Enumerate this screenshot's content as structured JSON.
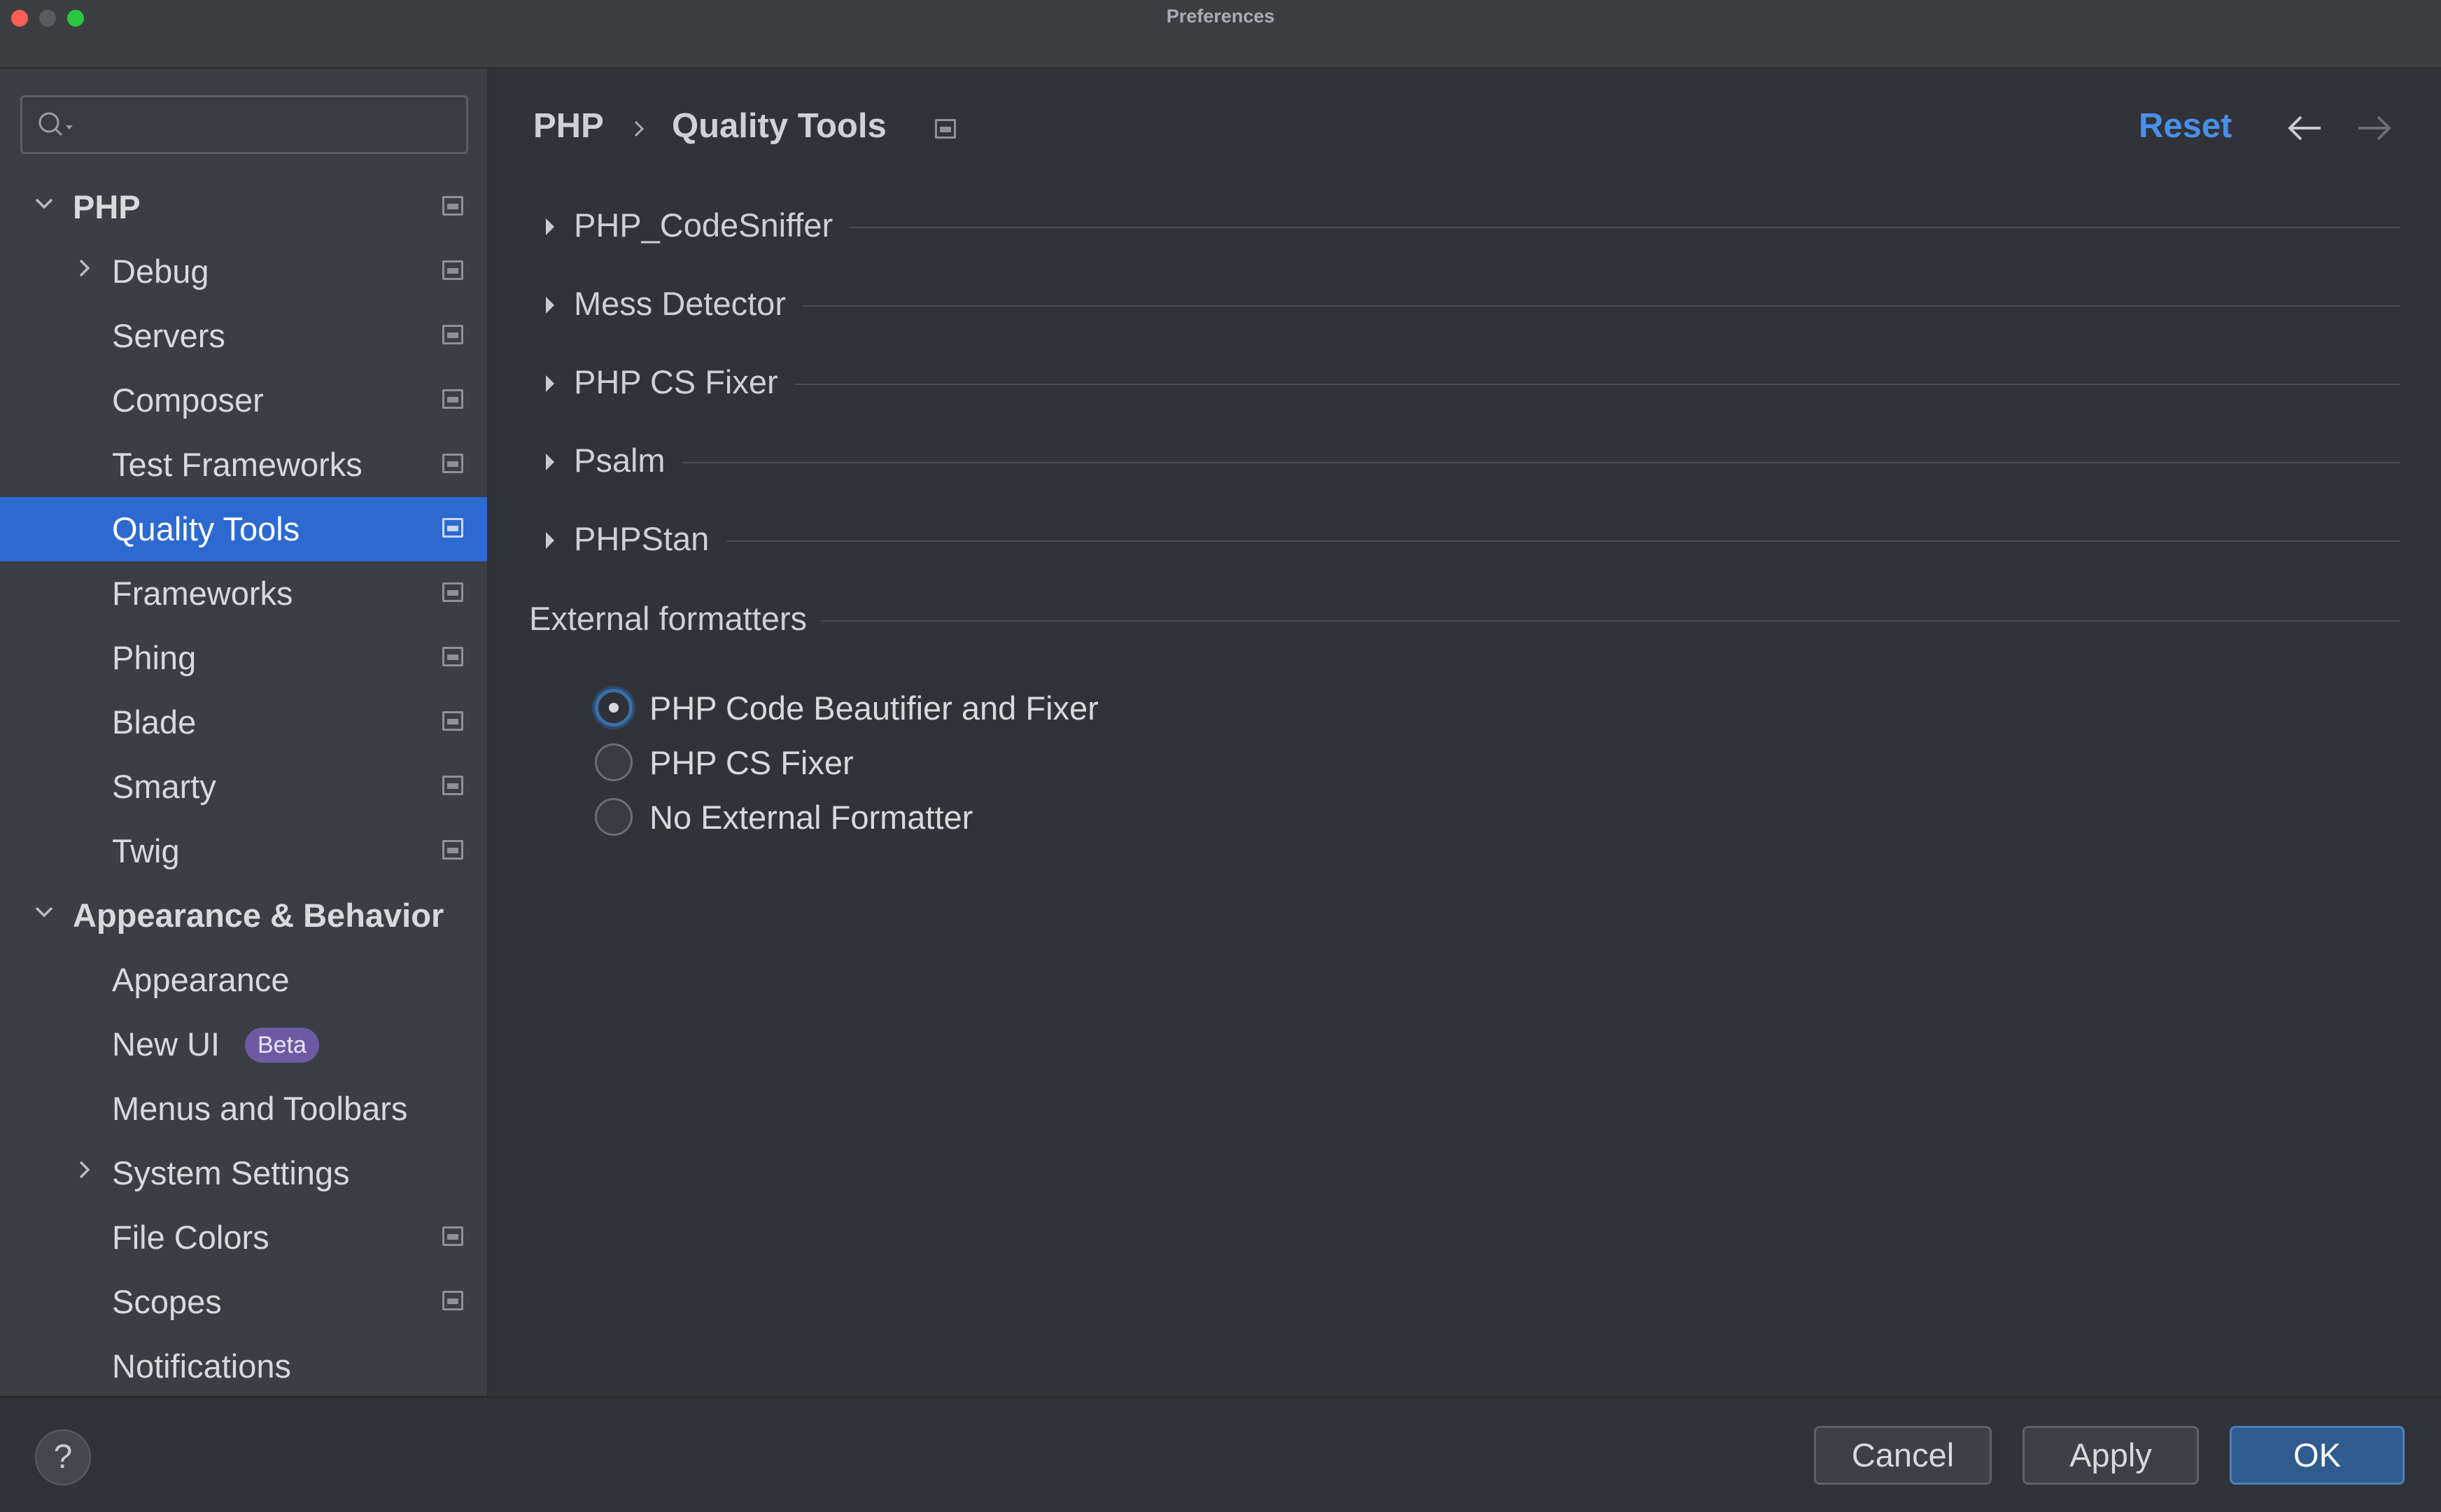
{
  "window": {
    "title": "Preferences"
  },
  "sidebar": {
    "search_placeholder": "",
    "items": [
      {
        "label": "PHP",
        "bold": true,
        "expanded": true,
        "level": 0
      },
      {
        "label": "Debug",
        "level": 1,
        "has_children": true
      },
      {
        "label": "Servers",
        "level": 1
      },
      {
        "label": "Composer",
        "level": 1
      },
      {
        "label": "Test Frameworks",
        "level": 1
      },
      {
        "label": "Quality Tools",
        "level": 1,
        "selected": true
      },
      {
        "label": "Frameworks",
        "level": 1
      },
      {
        "label": "Phing",
        "level": 1
      },
      {
        "label": "Blade",
        "level": 1
      },
      {
        "label": "Smarty",
        "level": 1
      },
      {
        "label": "Twig",
        "level": 1
      },
      {
        "label": "Appearance & Behavior",
        "bold": true,
        "expanded": true,
        "level": 0
      },
      {
        "label": "Appearance",
        "level": 1
      },
      {
        "label": "New UI",
        "level": 1,
        "badge": "Beta"
      },
      {
        "label": "Menus and Toolbars",
        "level": 1
      },
      {
        "label": "System Settings",
        "level": 1,
        "has_children": true
      },
      {
        "label": "File Colors",
        "level": 1
      },
      {
        "label": "Scopes",
        "level": 1
      },
      {
        "label": "Notifications",
        "level": 1
      }
    ]
  },
  "header": {
    "breadcrumb": [
      "PHP",
      "Quality Tools"
    ],
    "reset_label": "Reset"
  },
  "sections": [
    {
      "title": "PHP_CodeSniffer"
    },
    {
      "title": "Mess Detector"
    },
    {
      "title": "PHP CS Fixer"
    },
    {
      "title": "Psalm"
    },
    {
      "title": "PHPStan"
    }
  ],
  "external_formatters": {
    "title": "External formatters",
    "options": [
      {
        "label": "PHP Code Beautifier and Fixer",
        "checked": true
      },
      {
        "label": "PHP CS Fixer",
        "checked": false
      },
      {
        "label": "No External Formatter",
        "checked": false
      }
    ]
  },
  "footer": {
    "help_label": "?",
    "cancel_label": "Cancel",
    "apply_label": "Apply",
    "ok_label": "OK"
  },
  "colors": {
    "accent": "#2c6ad1",
    "link": "#4a8fe8",
    "beta_badge": "#6c5aa3"
  }
}
